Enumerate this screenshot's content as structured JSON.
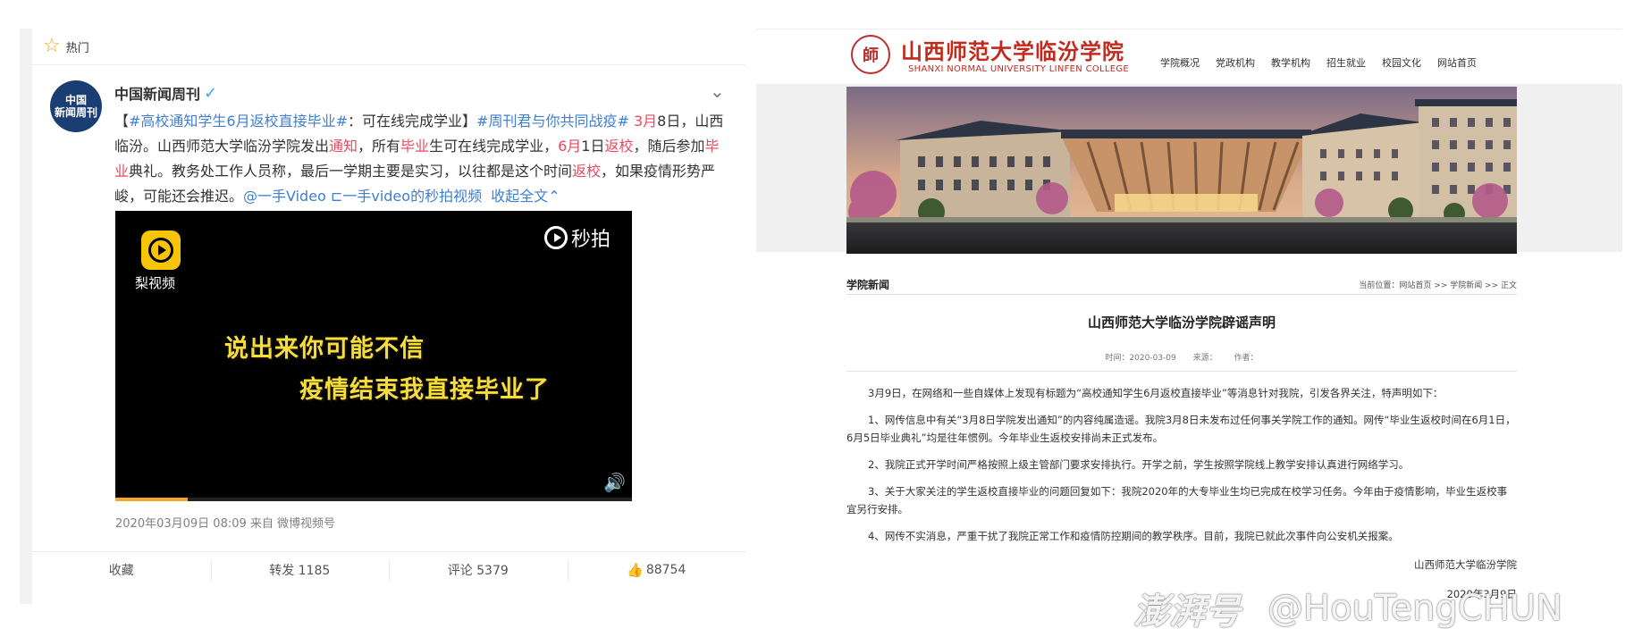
{
  "weibo": {
    "hot_label": "热门",
    "author": "中国新闻周刊",
    "avatar_text": [
      "中国",
      "新闻周刊"
    ],
    "post": {
      "tag1": "#高校通知学生6月返校直接毕业#",
      "lead": "【",
      "after_tag1": "：可在线完成学业】",
      "tag2": "#周刊君与你共同战疫#",
      "seg1": " ",
      "kw_3yue": "3月",
      "seg2": "8日，山西临汾。山西师范大学临汾学院发出",
      "kw_tongzhi": "通知",
      "seg3": "，所有",
      "kw_biye1": "毕业",
      "seg4": "生可在线完成学业，",
      "kw_6yue": "6月",
      "seg5": "1日",
      "kw_fanxiao1": "返校",
      "seg6": "，随后参加",
      "kw_biye2": "毕业",
      "seg7": "典礼。教务处工作人员称，最后一学期主要是实习，以往都是这个时间",
      "kw_fanxiao2": "返校",
      "seg8": "，如果疫情形势严峻，可能还会推迟。",
      "mention": "@一手Video",
      "video_link": "一手video的秒拍视频",
      "collapse": "收起全文"
    },
    "video": {
      "app_name": "梨视频",
      "brand": "秒拍",
      "subtitle1": "说出来你可能不信",
      "subtitle2": "疫情结束我直接毕业了",
      "progress": 0.14
    },
    "meta": "2020年03月09日 08:09  来自 微博视频号",
    "actions": {
      "favorite": "收藏",
      "repost": "转发 1185",
      "comment": "评论 5379",
      "like": "88754"
    }
  },
  "college": {
    "logo_char": "師",
    "name_cn": "山西师范大学临汾学院",
    "name_en": "SHANXI NORMAL UNIVERSITY LINFEN COLLEGE",
    "nav": [
      "学院概况",
      "党政机构",
      "教学机构",
      "招生就业",
      "校园文化",
      "网站首页"
    ],
    "section": "学院新闻",
    "breadcrumb": "当前位置：网站首页 >> 学院新闻 >> 正文",
    "article": {
      "title": "山西师范大学临汾学院辟谣声明",
      "time": "时间：2020-03-09",
      "source": "来源：",
      "author": "作者：",
      "paragraphs": [
        "3月9日，在网络和一些自媒体上发现有标题为“高校通知学生6月返校直接毕业”等消息针对我院，引发各界关注，特声明如下：",
        "1、网传信息中有关“3月8日学院发出通知”的内容纯属造谣。我院3月8日未发布过任何事关学院工作的通知。网传“毕业生返校时间在6月1日，6月5日毕业典礼”均是往年惯例。今年毕业生返校安排尚未正式发布。",
        "2、我院正式开学时间严格按照上级主管部门要求安排执行。开学之前，学生按照学院线上教学安排认真进行网络学习。",
        "3、关于大家关注的学生返校直接毕业的问题回复如下：我院2020年的大专毕业生均已完成在校学习任务。今年由于疫情影响，毕业生返校事宜另行安排。",
        "4、网传不实消息，严重干扰了我院正常工作和疫情防控期间的教学秩序。目前，我院已就此次事件向公安机关报案。"
      ],
      "signature": "山西师范大学临汾学院",
      "date": "2020年3月9日"
    }
  },
  "watermark": {
    "brand": "澎湃号",
    "handle": "@HouTengCHUN"
  },
  "colors": {
    "tag_blue": "#3e7fd2",
    "keyword_red": "#e84a5f",
    "college_red": "#c22a1e",
    "subtitle_yellow": "#f5dd3a"
  }
}
